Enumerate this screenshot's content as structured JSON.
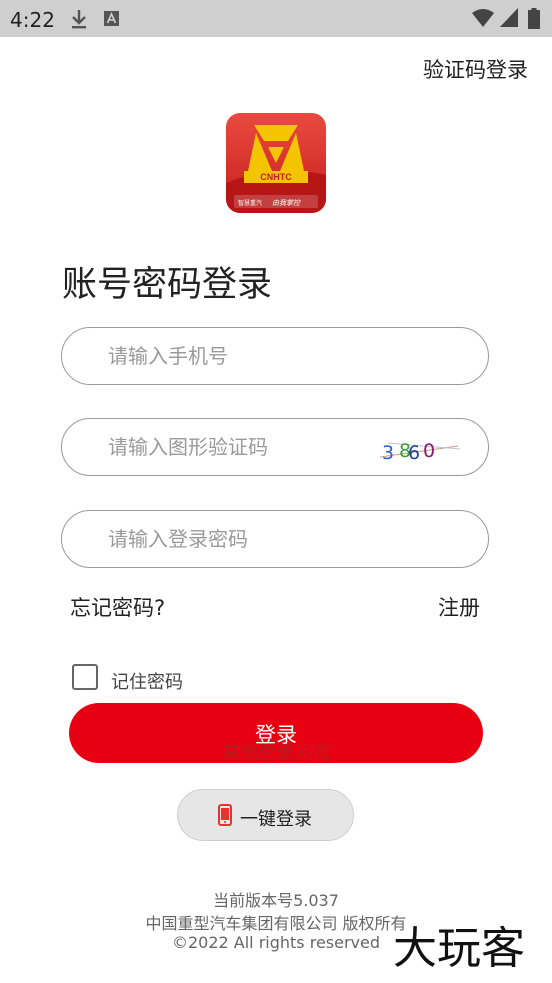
{
  "status_bar": {
    "time": "4:22",
    "icons": [
      "download-icon",
      "a-icon",
      "wifi-icon",
      "signal-icon",
      "battery-icon"
    ]
  },
  "header": {
    "sms_login_link": "验证码登录"
  },
  "logo": {
    "brand_text": "CNHTC",
    "slogan_left": "智慧重汽",
    "slogan_right": "由我掌控"
  },
  "page_title": "账号密码登录",
  "form": {
    "phone_placeholder": "请输入手机号",
    "captcha_placeholder": "请输入图形验证码",
    "captcha_code": [
      "3",
      "8",
      "6",
      "0"
    ],
    "password_placeholder": "请输入登录密码"
  },
  "links": {
    "forgot_password": "忘记密码?",
    "register": "注册"
  },
  "remember": {
    "label": "记住密码",
    "checked": false
  },
  "login_button": "登录",
  "other_methods_label": "其他登录方式",
  "onekey_login": {
    "label": "一键登录",
    "icon": "phone-icon"
  },
  "footer": {
    "version": "当前版本号5.037",
    "copyright_cn": "中国重型汽车集团有限公司 版权所有",
    "copyright_en": "©2022 All rights reserved"
  },
  "watermark": "大玩客",
  "colors": {
    "primary_red": "#e60012",
    "status_bar": "#cfcfcf",
    "logo_red": "#d7261e",
    "logo_yellow": "#f5c400"
  }
}
